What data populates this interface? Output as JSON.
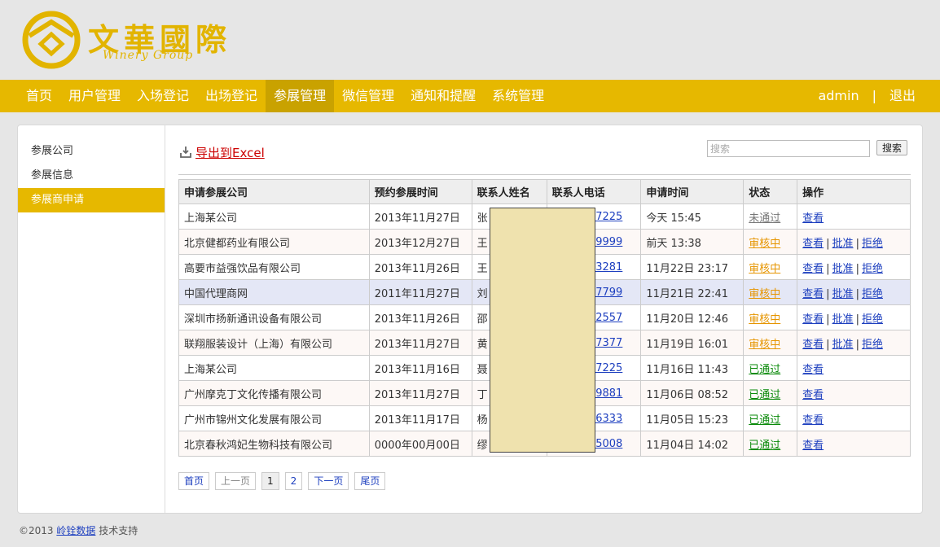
{
  "brand": {
    "name_cn": "文華國際",
    "name_en": "Winery Group",
    "color": "#e6b800"
  },
  "nav": {
    "items": [
      "首页",
      "用户管理",
      "入场登记",
      "出场登记",
      "参展管理",
      "微信管理",
      "通知和提醒",
      "系统管理"
    ],
    "active": "参展管理",
    "user": "admin",
    "divider": "|",
    "logout": "退出"
  },
  "sidebar": {
    "items": [
      "参展公司",
      "参展信息",
      "参展商申请"
    ],
    "active": "参展商申请"
  },
  "toolbar": {
    "export_icon": "download-icon",
    "export_label": "导出到Excel",
    "search_placeholder": "搜索",
    "search_button": "搜索"
  },
  "table": {
    "headers": [
      "申请参展公司",
      "预约参展时间",
      "联系人姓名",
      "联系人电话",
      "申请时间",
      "状态",
      "操作"
    ],
    "rows": [
      {
        "company": "上海某公司",
        "booking": "2013年11月27日",
        "contact": "张",
        "phone": "37225",
        "applied": "今天 15:45",
        "status": "未通过",
        "status_type": "fail",
        "actions": [
          "查看"
        ]
      },
      {
        "company": "北京健都药业有限公司",
        "booking": "2013年12月27日",
        "contact": "王",
        "phone": "09999",
        "applied": "前天 13:38",
        "status": "审核中",
        "status_type": "pending",
        "actions": [
          "查看",
          "批准",
          "拒绝"
        ]
      },
      {
        "company": "高要市益强饮品有限公司",
        "booking": "2013年11月26日",
        "contact": "王",
        "phone": "03281",
        "applied": "11月22日 23:17",
        "status": "审核中",
        "status_type": "pending",
        "actions": [
          "查看",
          "批准",
          "拒绝"
        ]
      },
      {
        "company": "中国代理商网",
        "booking": "2011年11月27日",
        "contact": "刘",
        "phone": "17799",
        "applied": "11月21日 22:41",
        "status": "审核中",
        "status_type": "pending",
        "actions": [
          "查看",
          "批准",
          "拒绝"
        ]
      },
      {
        "company": "深圳市扬新通讯设备有限公司",
        "booking": "2013年11月26日",
        "contact": "邵",
        "phone": "02557",
        "applied": "11月20日 12:46",
        "status": "审核中",
        "status_type": "pending",
        "actions": [
          "查看",
          "批准",
          "拒绝"
        ]
      },
      {
        "company": "联翔服装设计（上海）有限公司",
        "booking": "2013年11月27日",
        "contact": "黄",
        "phone": "47377",
        "applied": "11月19日 16:01",
        "status": "审核中",
        "status_type": "pending",
        "actions": [
          "查看",
          "批准",
          "拒绝"
        ]
      },
      {
        "company": "上海某公司",
        "booking": "2013年11月16日",
        "contact": "聂",
        "phone": "37225",
        "applied": "11月16日 11:43",
        "status": "已通过",
        "status_type": "pass",
        "actions": [
          "查看"
        ]
      },
      {
        "company": "广州摩克丁文化传播有限公司",
        "booking": "2013年11月27日",
        "contact": "丁",
        "phone": "09881",
        "applied": "11月06日 08:52",
        "status": "已通过",
        "status_type": "pass",
        "actions": [
          "查看"
        ]
      },
      {
        "company": "广州市锦州文化发展有限公司",
        "booking": "2013年11月17日",
        "contact": "杨",
        "phone": "06333",
        "applied": "11月05日 15:23",
        "status": "已通过",
        "status_type": "pass",
        "actions": [
          "查看"
        ]
      },
      {
        "company": "北京春秋鸿妃生物科技有限公司",
        "booking": "0000年00月00日",
        "contact": "缪",
        "phone": "65008",
        "applied": "11月04日 14:02",
        "status": "已通过",
        "status_type": "pass",
        "actions": [
          "查看"
        ]
      }
    ],
    "highlighted_row": 3
  },
  "pager": {
    "first": "首页",
    "prev": "上一页",
    "pages": [
      "1",
      "2"
    ],
    "current": "1",
    "next": "下一页",
    "last": "尾页"
  },
  "footer": {
    "copyright": "©2013",
    "company_link": "岭铨数据",
    "suffix": "技术支持"
  }
}
